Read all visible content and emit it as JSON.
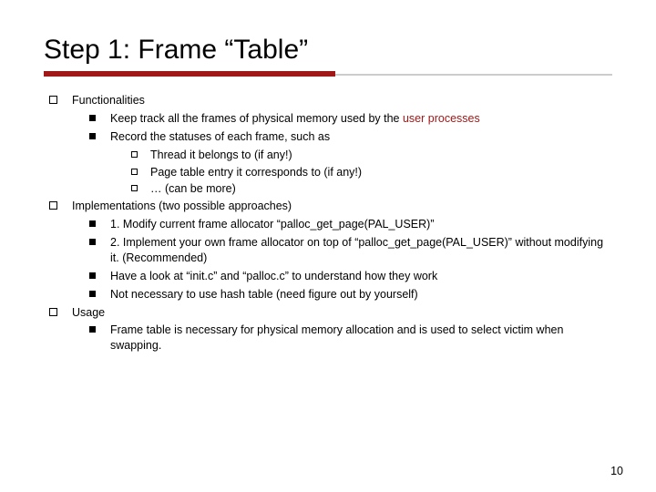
{
  "title": "Step 1: Frame “Table”",
  "sections": {
    "s1": {
      "head": "Functionalities",
      "b1a": "Keep track all the frames of physical memory used by the ",
      "b1b": "user processes",
      "b2": "Record the statuses of each frame, such as",
      "c1": "Thread it belongs to (if any!)",
      "c2": "Page table entry it corresponds to (if any!)",
      "c3": "… (can be more)"
    },
    "s2": {
      "head": "Implementations (two possible approaches)",
      "b1": "1. Modify current frame allocator “palloc_get_page(PAL_USER)”",
      "b2": "2. Implement your own frame allocator on top of “palloc_get_page(PAL_USER)” without modifying it. (Recommended)",
      "b3": "Have a look at “init.c” and “palloc.c” to understand how they work",
      "b4": "Not necessary to use hash table (need figure out by yourself)"
    },
    "s3": {
      "head": "Usage",
      "b1": "Frame table is necessary for physical memory allocation and is used to select victim when swapping."
    }
  },
  "slide_number": "10"
}
